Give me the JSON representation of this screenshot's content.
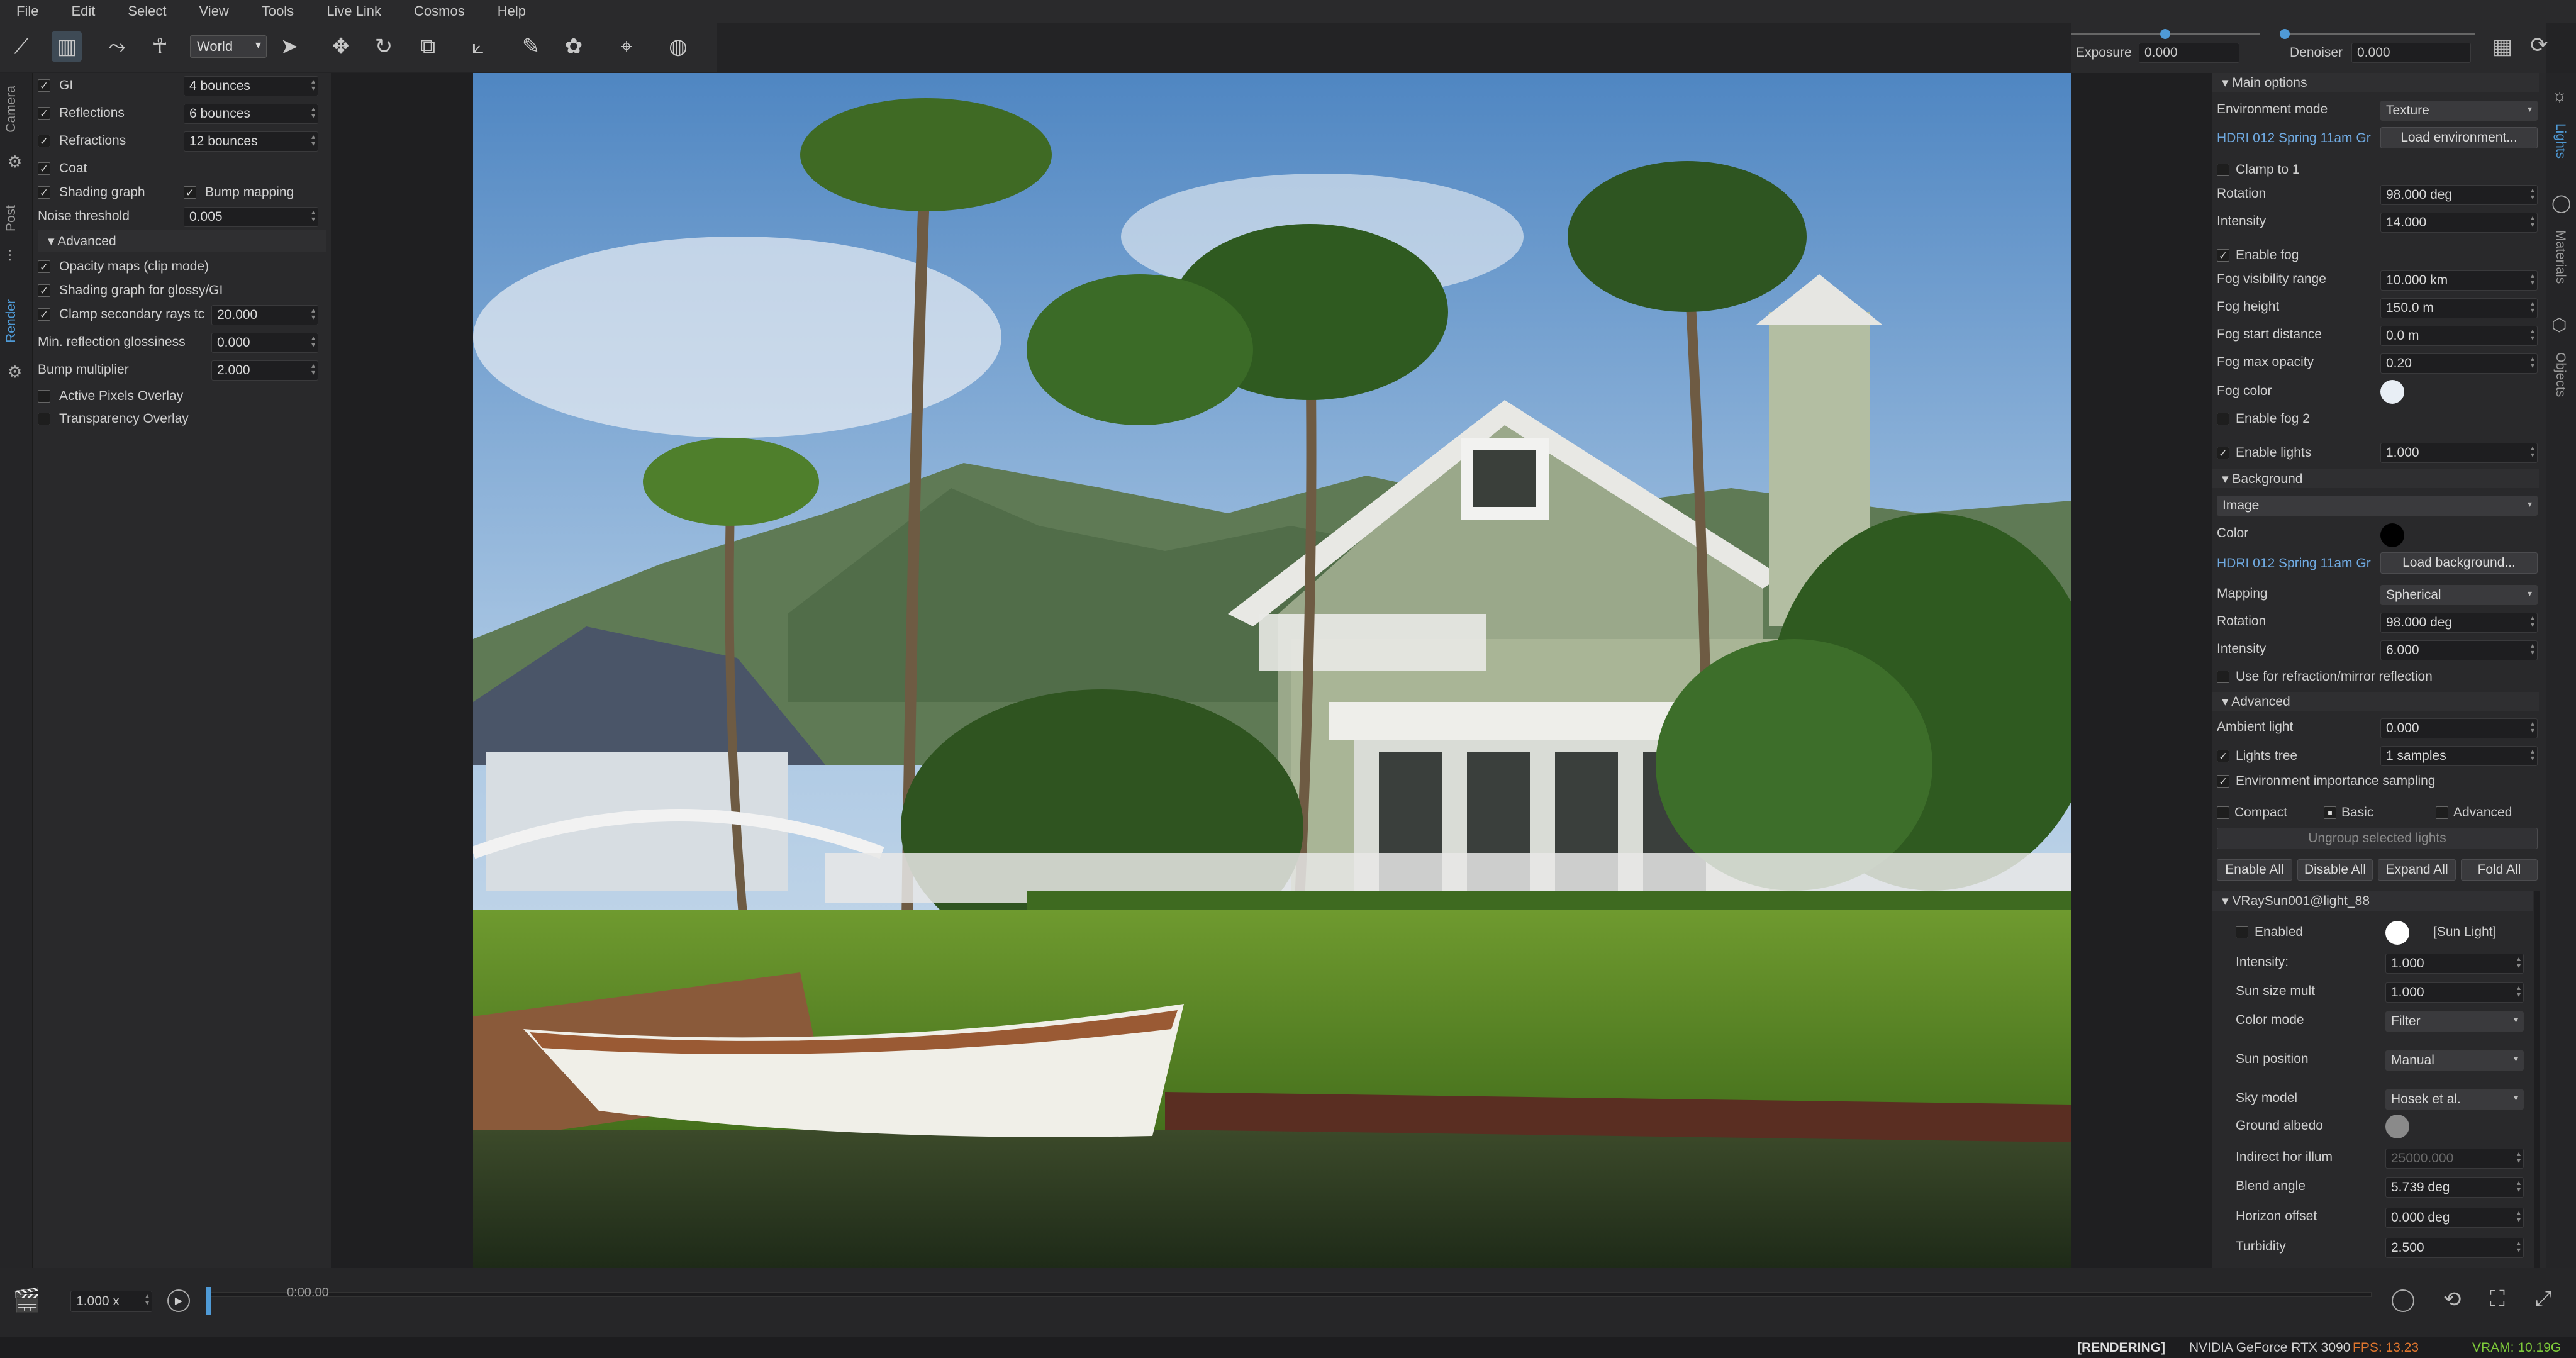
{
  "menu": [
    "File",
    "Edit",
    "Select",
    "View",
    "Tools",
    "Live Link",
    "Cosmos",
    "Help"
  ],
  "toolbar": {
    "space_select": "World",
    "icons": [
      "select-mode-icon",
      "vray-icon",
      "path-icon",
      "walk-icon",
      "pointer-icon",
      "move-icon",
      "rotate-icon",
      "scale-icon",
      "gizmo-icon",
      "paint-icon",
      "scatter-icon",
      "target-icon",
      "palette-icon"
    ]
  },
  "left_tabs": [
    "Camera",
    "Post",
    "Render"
  ],
  "left_panel": {
    "rows": [
      {
        "label": "GI",
        "checked": true,
        "value": "4 bounces"
      },
      {
        "label": "Reflections",
        "checked": true,
        "value": "6 bounces"
      },
      {
        "label": "Refractions",
        "checked": true,
        "value": "12 bounces"
      },
      {
        "label": "Coat",
        "checked": true
      },
      {
        "label": "Shading graph",
        "checked": true,
        "label2": "Bump mapping",
        "checked2": true
      },
      {
        "label": "Noise threshold",
        "value": "0.005"
      }
    ],
    "advanced_title": "Advanced",
    "advanced_rows": [
      {
        "label": "Opacity maps (clip mode)",
        "checked": true
      },
      {
        "label": "Shading graph for glossy/GI",
        "checked": true
      },
      {
        "label": "Clamp secondary rays tc",
        "checked": true,
        "value": "20.000"
      },
      {
        "label": "Min. reflection glossiness",
        "value": "0.000"
      },
      {
        "label": "Bump multiplier",
        "value": "2.000"
      },
      {
        "label": "Active Pixels Overlay",
        "checked": false
      },
      {
        "label": "Transparency Overlay",
        "checked": false
      }
    ]
  },
  "right_top": {
    "exposure_label": "Exposure",
    "exposure_value": "0.000",
    "denoiser_label": "Denoiser",
    "denoiser_value": "0.000"
  },
  "right_tabs": [
    "Lights",
    "Materials",
    "Objects"
  ],
  "right_panel": {
    "main_options": "Main options",
    "env_mode_label": "Environment mode",
    "env_mode_value": "Texture",
    "hdri_name": "HDRI 012 Spring 11am Gr",
    "load_env": "Load environment...",
    "clamp_label": "Clamp to 1",
    "rotation_label": "Rotation",
    "rotation_value": "98.000 deg",
    "intensity_label": "Intensity",
    "intensity_value": "14.000",
    "enable_fog": "Enable fog",
    "fog_vis_label": "Fog visibility range",
    "fog_vis_value": "10.000 km",
    "fog_height_label": "Fog height",
    "fog_height_value": "150.0 m",
    "fog_start_label": "Fog start distance",
    "fog_start_value": "0.0 m",
    "fog_opacity_label": "Fog max opacity",
    "fog_opacity_value": "0.20",
    "fog_color_label": "Fog color",
    "fog_color": "#e8eef5",
    "enable_fog2": "Enable fog 2",
    "enable_lights": "Enable lights",
    "enable_lights_value": "1.000",
    "background_title": "Background",
    "bg_mode_value": "Image",
    "color_label": "Color",
    "bg_color": "#000000",
    "hdri_bg_name": "HDRI 012 Spring 11am Gr",
    "load_bg": "Load background...",
    "mapping_label": "Mapping",
    "mapping_value": "Spherical",
    "bg_rotation_label": "Rotation",
    "bg_rotation_value": "98.000 deg",
    "bg_intensity_label": "Intensity",
    "bg_intensity_value": "6.000",
    "use_refraction": "Use for refraction/mirror reflection",
    "advanced_title": "Advanced",
    "ambient_label": "Ambient light",
    "ambient_value": "0.000",
    "lights_tree_label": "Lights tree",
    "lights_tree_value": "1 samples",
    "env_importance": "Environment importance sampling",
    "compact": "Compact",
    "basic": "Basic",
    "advanced": "Advanced",
    "ungroup": "Ungroup selected lights",
    "enable_all": "Enable All",
    "disable_all": "Disable All",
    "expand_all": "Expand All",
    "fold_all": "Fold All",
    "sun_title": "VRaySun001@light_88",
    "enabled_label": "Enabled",
    "sun_tag": "[Sun Light]",
    "sun_color": "#ffffff",
    "sun_rows": [
      {
        "label": "Intensity:",
        "value": "1.000"
      },
      {
        "label": "Sun size mult",
        "value": "1.000"
      },
      {
        "label": "Color mode",
        "value": "Filter",
        "dropdown": true
      },
      {
        "label": "Sun position",
        "value": "Manual",
        "dropdown": true
      },
      {
        "label": "Sky model",
        "value": "Hosek et al.",
        "dropdown": true
      },
      {
        "label": "Ground albedo",
        "swatch": "#8a8a8a"
      },
      {
        "label": "Indirect hor illum",
        "value": "25000.000",
        "disabled": true
      },
      {
        "label": "Blend angle",
        "value": "5.739 deg"
      },
      {
        "label": "Horizon offset",
        "value": "0.000 deg"
      },
      {
        "label": "Turbidity",
        "value": "2.500"
      }
    ]
  },
  "timeline": {
    "speed": "1.000 x",
    "time": "0:00.00"
  },
  "status": {
    "rendering": "[RENDERING]",
    "gpu": "NVIDIA GeForce RTX 3090",
    "fps": "FPS: 13.23",
    "vram": "VRAM: 10.19G"
  }
}
